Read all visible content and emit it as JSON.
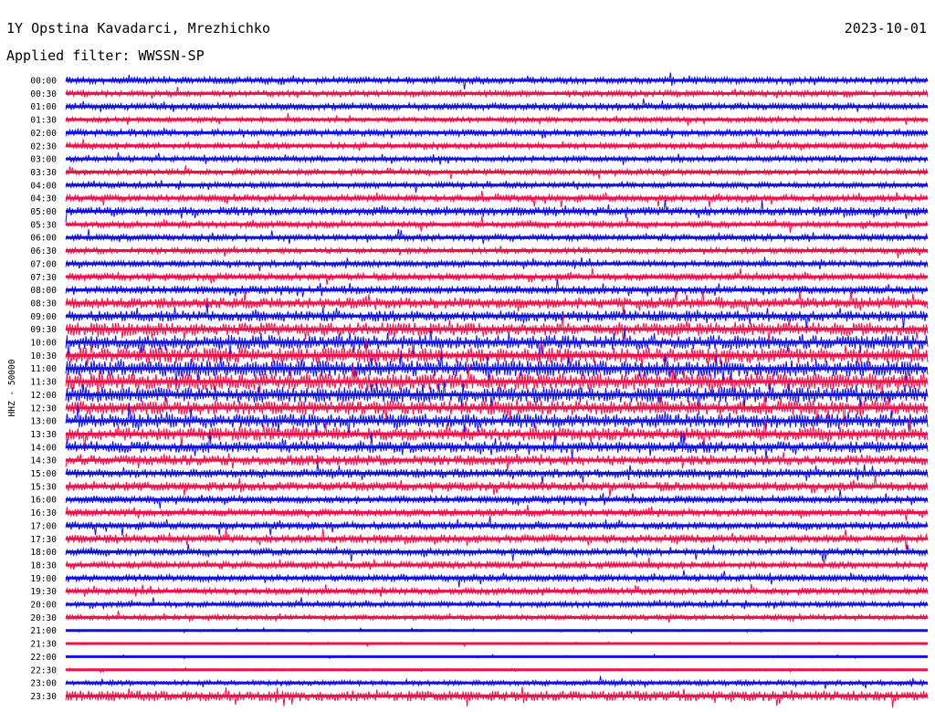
{
  "header": {
    "station": "1Y Opstina Kavadarci, Mrezhichko",
    "date": "2023-10-01",
    "filter": "Applied filter: WWSSN-SP"
  },
  "chart_data": {
    "type": "line",
    "title": "1Y Opstina Kavadarci, Mrezhichko",
    "subtitle": "Applied filter: WWSSN-SP",
    "date": "2023-10-01",
    "ylabel": "HHZ - 50000",
    "xlabel": "",
    "grid": false,
    "row_labels": [
      "00:00",
      "00:30",
      "01:00",
      "01:30",
      "02:00",
      "02:30",
      "03:00",
      "03:30",
      "04:00",
      "04:30",
      "05:00",
      "05:30",
      "06:00",
      "06:30",
      "07:00",
      "07:30",
      "08:00",
      "08:30",
      "09:00",
      "09:30",
      "10:00",
      "10:30",
      "11:00",
      "11:30",
      "12:00",
      "12:30",
      "13:00",
      "13:30",
      "14:00",
      "14:30",
      "15:00",
      "15:30",
      "16:00",
      "16:30",
      "17:00",
      "17:30",
      "18:00",
      "18:30",
      "19:00",
      "19:30",
      "20:00",
      "20:30",
      "21:00",
      "21:30",
      "22:00",
      "22:30",
      "23:00",
      "23:30"
    ],
    "series_colors": [
      "#1010e0",
      "#f0104a"
    ],
    "amplitude_levels": [
      0.55,
      0.45,
      0.55,
      0.4,
      0.55,
      0.5,
      0.45,
      0.45,
      0.45,
      0.55,
      0.7,
      0.5,
      0.5,
      0.45,
      0.5,
      0.55,
      0.65,
      0.85,
      0.85,
      1.0,
      1.1,
      1.2,
      1.25,
      1.25,
      1.2,
      1.1,
      1.1,
      1.0,
      0.9,
      0.8,
      0.7,
      0.7,
      0.6,
      0.6,
      0.6,
      0.65,
      0.55,
      0.55,
      0.55,
      0.5,
      0.45,
      0.4,
      0.15,
      0.15,
      0.12,
      0.15,
      0.4,
      0.8
    ]
  }
}
